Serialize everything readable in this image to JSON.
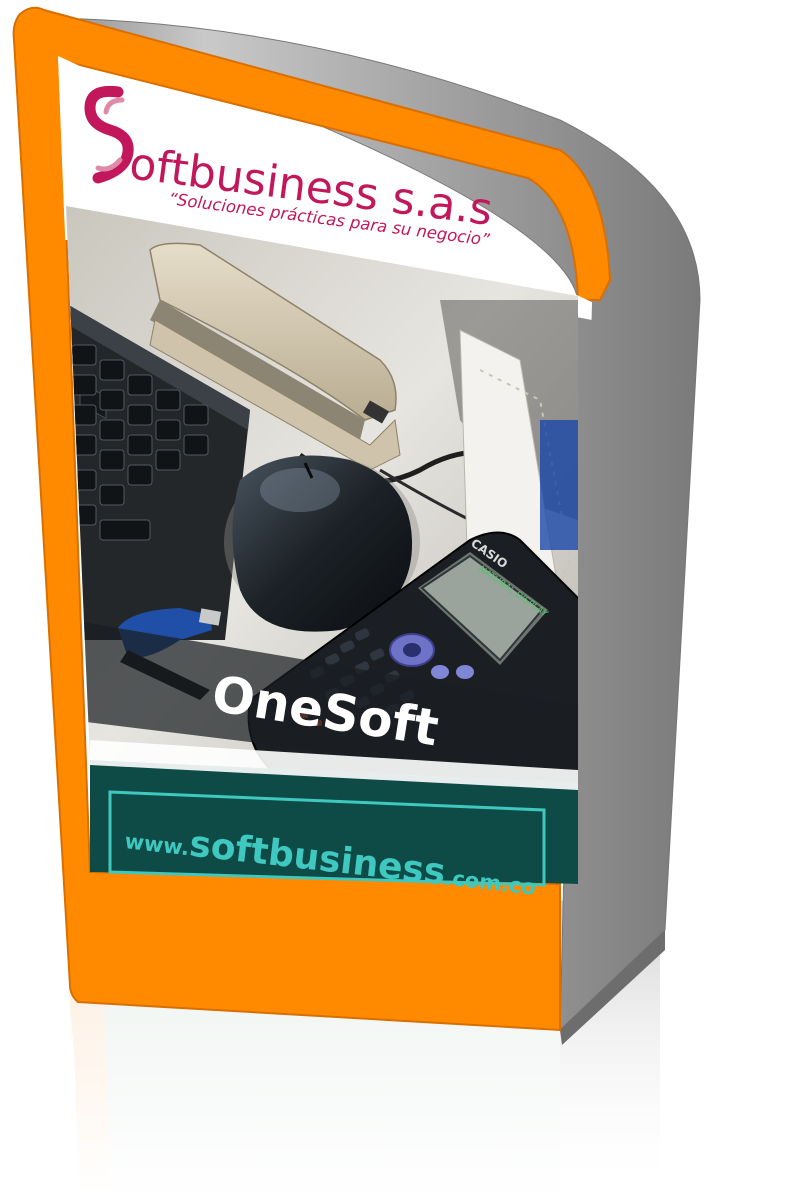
{
  "brand": {
    "logo_letter": "S",
    "name": "oftbusiness s.a.s",
    "slogan": "“Soluciones prácticas para su negocio”"
  },
  "product": {
    "name": "OneSoft"
  },
  "website": {
    "prefix": "www.",
    "domain": "softbusiness",
    "suffix": ".com.co"
  },
  "calculator": {
    "brand": "CASIO",
    "display_label": "NATURAL DISPLAY"
  },
  "colors": {
    "frame": "#ff8a00",
    "box_side": "#a8a8a8",
    "brand": "#c2185b",
    "teal_bar": "#0e4a46",
    "url_text": "#3fc8bf"
  }
}
